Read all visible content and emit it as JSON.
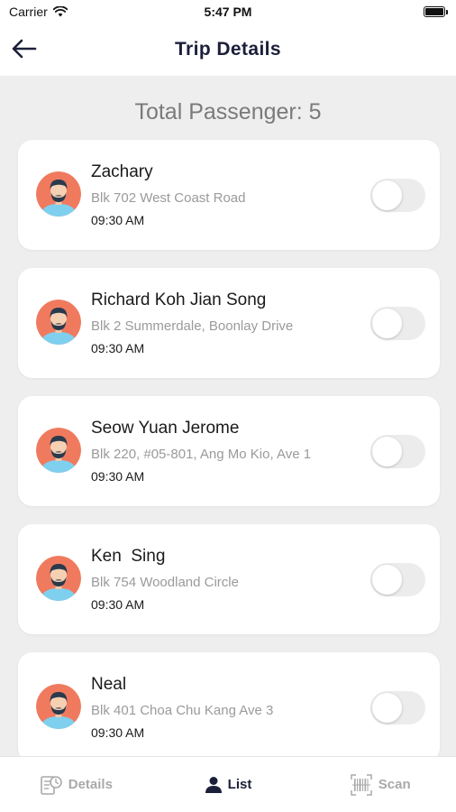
{
  "status_bar": {
    "carrier": "Carrier",
    "time": "5:47 PM"
  },
  "header": {
    "title": "Trip Details",
    "back_icon": "arrow-left-icon"
  },
  "summary": {
    "total_label": "Total Passenger: 5"
  },
  "passengers": [
    {
      "name": "Zachary",
      "address": "Blk 702 West Coast Road",
      "time": "09:30 AM"
    },
    {
      "name": "Richard Koh Jian Song",
      "address": "Blk 2 Summerdale, Boonlay Drive",
      "time": "09:30 AM"
    },
    {
      "name": "Seow Yuan Jerome",
      "address": "Blk 220, #05-801, Ang Mo Kio, Ave 1",
      "time": "09:30 AM"
    },
    {
      "name": "Ken  Sing",
      "address": "Blk 754 Woodland Circle",
      "time": "09:30 AM"
    },
    {
      "name": "Neal",
      "address": "Blk 401 Choa Chu Kang Ave 3",
      "time": "09:30 AM"
    }
  ],
  "tabs": [
    {
      "label": "Details",
      "icon": "details-icon",
      "active": false
    },
    {
      "label": "List",
      "icon": "person-icon",
      "active": true
    },
    {
      "label": "Scan",
      "icon": "barcode-icon",
      "active": false
    }
  ],
  "colors": {
    "accent": "#1c1f3a",
    "background": "#eeeeee",
    "avatar_bg": "#f07a5e",
    "avatar_shirt": "#7fcfee"
  }
}
